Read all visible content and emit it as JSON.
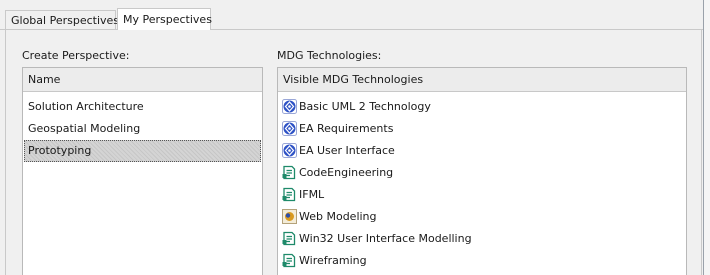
{
  "tabs": [
    {
      "label": "Global Perspectives",
      "active": false
    },
    {
      "label": "My Perspectives",
      "active": true
    }
  ],
  "create_perspective": {
    "section_label": "Create Perspective:",
    "column_header": "Name",
    "items": [
      {
        "label": "Solution Architecture",
        "selected": false
      },
      {
        "label": "Geospatial Modeling",
        "selected": false
      },
      {
        "label": "Prototyping",
        "selected": true
      }
    ]
  },
  "mdg_technologies": {
    "section_label": "MDG Technologies:",
    "column_header": "Visible MDG Technologies",
    "items": [
      {
        "label": "Basic UML 2 Technology",
        "icon": "uml-technology-icon"
      },
      {
        "label": "EA Requirements",
        "icon": "uml-technology-icon"
      },
      {
        "label": "EA User Interface",
        "icon": "uml-technology-icon"
      },
      {
        "label": "CodeEngineering",
        "icon": "mdg-technology-icon"
      },
      {
        "label": "IFML",
        "icon": "mdg-technology-icon"
      },
      {
        "label": "Web Modeling",
        "icon": "web-modeling-icon"
      },
      {
        "label": "Win32 User Interface Modelling",
        "icon": "mdg-technology-icon"
      },
      {
        "label": "Wireframing",
        "icon": "mdg-technology-icon"
      }
    ]
  },
  "colors": {
    "uml_icon": "#2f53c6",
    "mdg_icon": "#1e8a6a",
    "web_icon": "#d99a20"
  }
}
